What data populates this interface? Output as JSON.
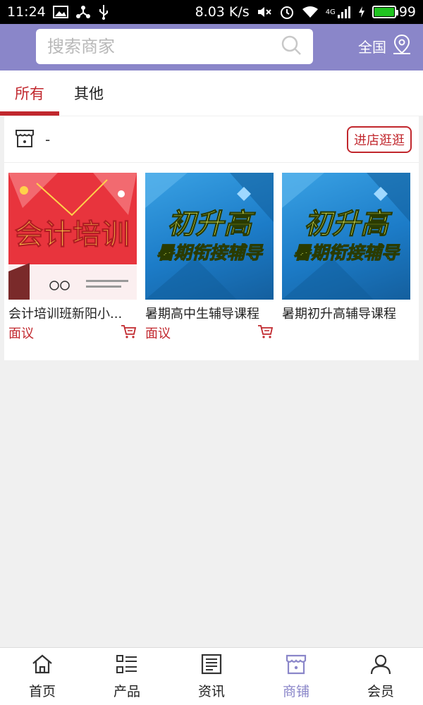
{
  "status_bar": {
    "time": "11:24",
    "speed": "8.03 K/s",
    "network": "4G",
    "battery": "99",
    "battery_level": 0.99
  },
  "header": {
    "search_placeholder": "搜索商家",
    "region_label": "全国"
  },
  "tabs": [
    {
      "label": "所有",
      "active": true
    },
    {
      "label": "其他",
      "active": false
    }
  ],
  "store": {
    "name": "-",
    "visit_label": "进店逛逛",
    "icon": "store-icon"
  },
  "products": [
    {
      "name": "会计培训班新阳小...",
      "price": "面议",
      "image_text": "会计培训",
      "theme": "red",
      "cart": true
    },
    {
      "name": "暑期高中生辅导课程",
      "price": "面议",
      "image_text_1": "初升高",
      "image_text_2": "暑期衔接辅导",
      "theme": "blue",
      "cart": true
    },
    {
      "name": "暑期初升高辅导课程",
      "price": "",
      "image_text_1": "初升高",
      "image_text_2": "暑期衔接辅导",
      "theme": "blue",
      "cart": false
    }
  ],
  "bottom_nav": [
    {
      "label": "首页",
      "icon": "home-icon",
      "active": false
    },
    {
      "label": "产品",
      "icon": "list-icon",
      "active": false
    },
    {
      "label": "资讯",
      "icon": "news-icon",
      "active": false
    },
    {
      "label": "商铺",
      "icon": "store-icon",
      "active": true
    },
    {
      "label": "会员",
      "icon": "user-icon",
      "active": false
    }
  ],
  "colors": {
    "header": "#8a86c9",
    "accent": "#c1272d",
    "nav_active": "#8a86c9"
  }
}
